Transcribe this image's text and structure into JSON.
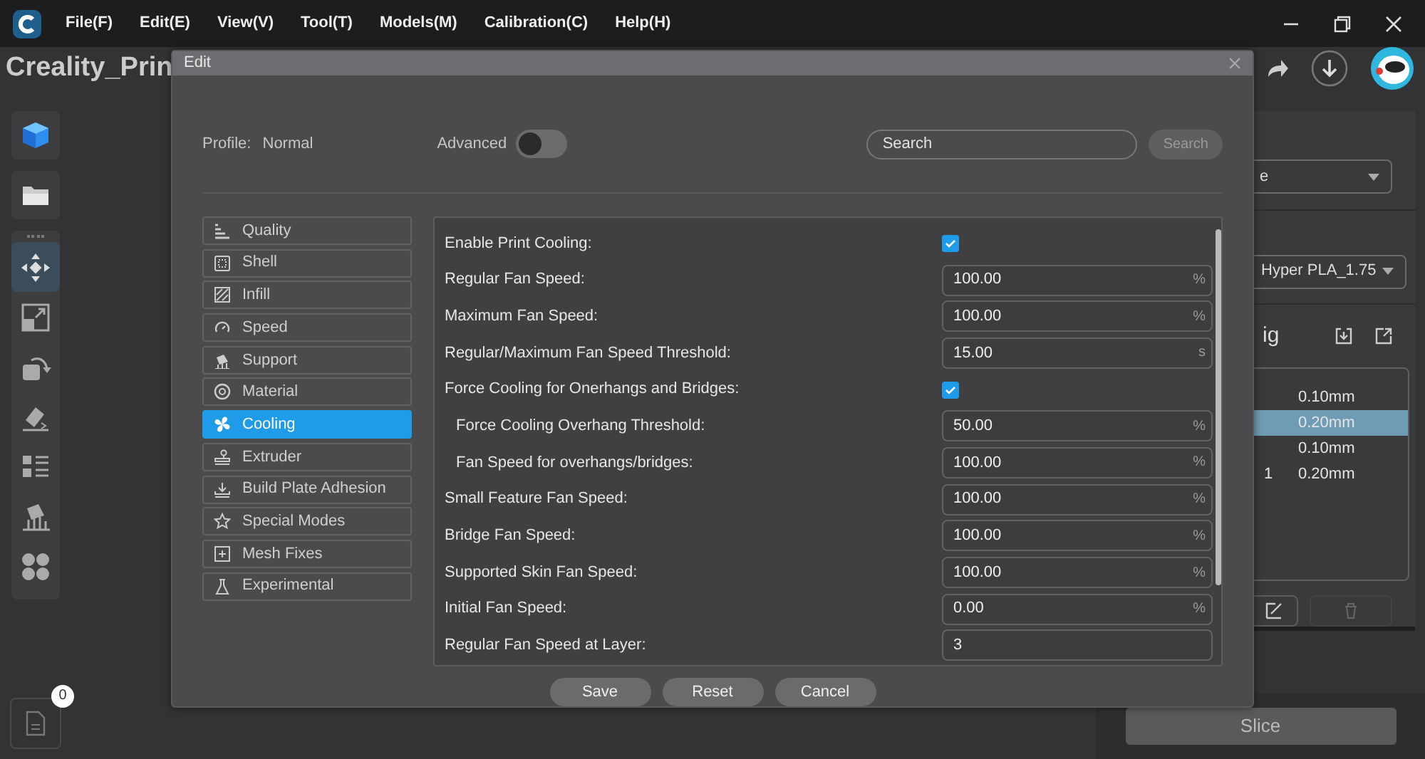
{
  "app": {
    "menu": [
      "File(F)",
      "Edit(E)",
      "View(V)",
      "Tool(T)",
      "Models(M)",
      "Calibration(C)",
      "Help(H)"
    ],
    "title": "Creality_Prin"
  },
  "toolbar": {
    "tools": [
      {
        "selected": true
      },
      {
        "selected": false
      },
      {
        "selected": false
      },
      {
        "selected": false
      },
      {
        "selected": false
      },
      {
        "selected": false
      },
      {
        "selected": false
      }
    ],
    "file_badge": "0"
  },
  "right_panel": {
    "preset": "e",
    "material": "Hyper PLA_1.75",
    "section_title": "ig",
    "rows": [
      {
        "value": "0.10mm",
        "selected": false
      },
      {
        "value": "0.20mm",
        "selected": true
      },
      {
        "value": "0.10mm",
        "selected": false
      },
      {
        "column_1": "1",
        "value": "0.20mm",
        "selected": false
      }
    ],
    "slice_button": "Slice"
  },
  "dialog": {
    "title": "Edit",
    "profile_label": "Profile:",
    "profile": "Normal",
    "advanced_label": "Advanced",
    "advanced_on": false,
    "search_placeholder": "Search",
    "search_button": {
      "label": "Search",
      "disabled": true
    },
    "categories": [
      {
        "label": "Quality",
        "selected": false
      },
      {
        "label": "Shell",
        "selected": false
      },
      {
        "label": "Infill",
        "selected": false
      },
      {
        "label": "Speed",
        "selected": false
      },
      {
        "label": "Support",
        "selected": false
      },
      {
        "label": "Material",
        "selected": false
      },
      {
        "label": "Cooling",
        "selected": true
      },
      {
        "label": "Extruder",
        "selected": false
      },
      {
        "label": "Build Plate Adhesion",
        "selected": false
      },
      {
        "label": "Special Modes",
        "selected": false
      },
      {
        "label": "Mesh Fixes",
        "selected": false
      },
      {
        "label": "Experimental",
        "selected": false
      }
    ],
    "settings": [
      {
        "kind": "checkbox",
        "label": "Enable Print Cooling:",
        "checked": true
      },
      {
        "kind": "number",
        "label": "Regular Fan Speed:",
        "value": "100.00",
        "unit": "%"
      },
      {
        "kind": "number",
        "label": "Maximum Fan Speed:",
        "value": "100.00",
        "unit": "%"
      },
      {
        "kind": "number",
        "label": "Regular/Maximum Fan Speed Threshold:",
        "value": "15.00",
        "unit": "s"
      },
      {
        "kind": "checkbox",
        "label": "Force Cooling for Onerhangs and Bridges:",
        "checked": true,
        "children": [
          {
            "kind": "number",
            "label": "Force Cooling Overhang Threshold:",
            "value": "50.00",
            "unit": "%"
          },
          {
            "kind": "number",
            "label": "Fan Speed for overhangs/bridges:",
            "value": "100.00",
            "unit": "%"
          }
        ]
      },
      {
        "kind": "number",
        "label": "Small Feature Fan Speed:",
        "value": "100.00",
        "unit": "%"
      },
      {
        "kind": "number",
        "label": "Bridge Fan Speed:",
        "value": "100.00",
        "unit": "%"
      },
      {
        "kind": "number",
        "label": "Supported Skin Fan Speed:",
        "value": "100.00",
        "unit": "%"
      },
      {
        "kind": "number",
        "label": "Initial Fan Speed:",
        "value": "0.00",
        "unit": "%"
      },
      {
        "kind": "number",
        "label": "Regular Fan Speed at Layer:",
        "value": "3"
      }
    ],
    "buttons": [
      "Save",
      "Reset",
      "Cancel"
    ]
  }
}
